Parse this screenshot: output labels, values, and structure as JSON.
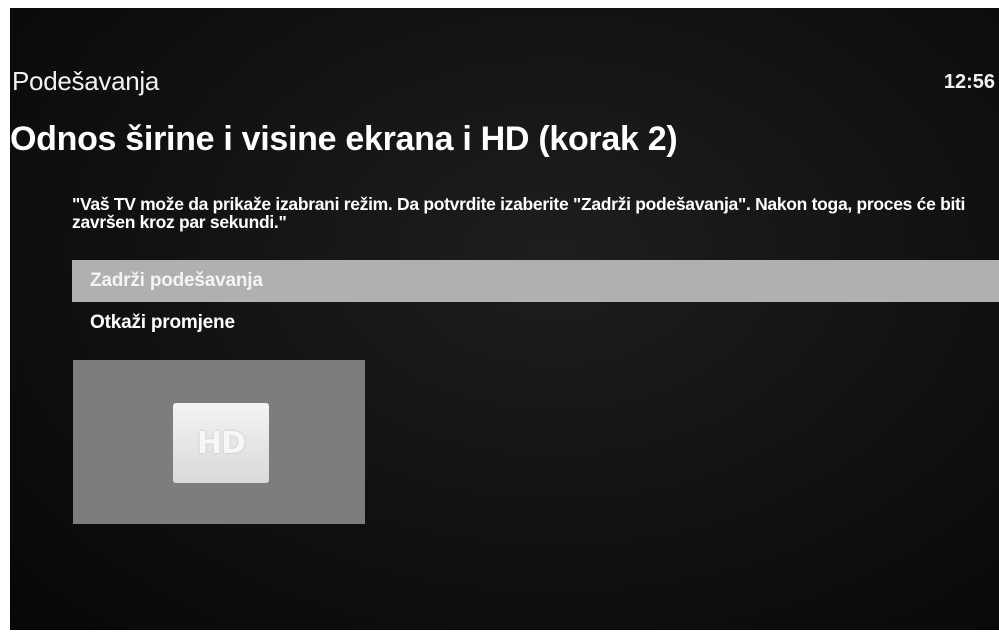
{
  "header": {
    "section_title": "Podešavanja",
    "clock": "12:56"
  },
  "page": {
    "heading": "Odnos širine i visine ekrana i HD (korak 2)",
    "message": "\"Vaš TV može da prikaže izabrani režim. Da potvrdite izaberite \"Zadrži podešavanja\". Nakon toga, proces će biti završen kroz par sekundi.\""
  },
  "menu": {
    "items": [
      {
        "label": "Zadrži podešavanja",
        "selected": true
      },
      {
        "label": "Otkaži promjene",
        "selected": false
      }
    ]
  },
  "preview": {
    "badge": "HD",
    "icon": "hd-icon"
  },
  "colors": {
    "background": "#111111",
    "selection": "#b0b0b0",
    "preview_panel": "#7d7d7d"
  }
}
